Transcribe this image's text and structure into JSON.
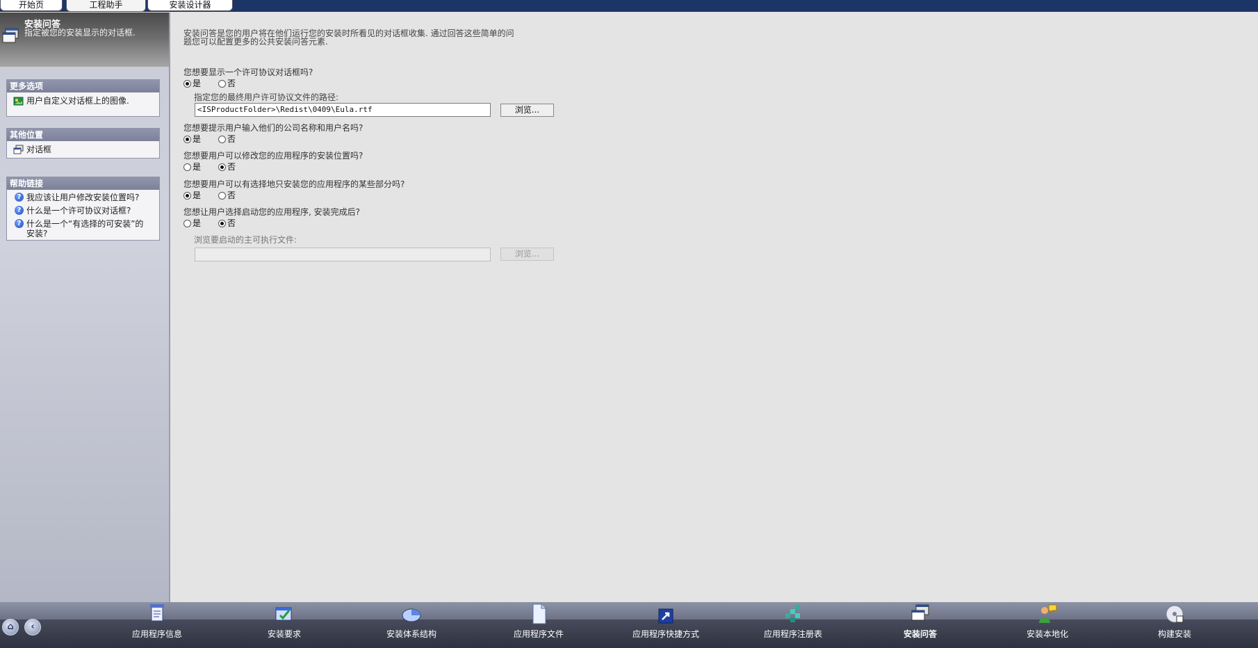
{
  "tabs": [
    {
      "label": "开始页"
    },
    {
      "label": "工程助手"
    },
    {
      "label": "安装设计器"
    }
  ],
  "left_panel": {
    "title": "安装问答",
    "subtitle": "指定被您的安装显示的对话框.",
    "more_options": {
      "heading": "更多选项",
      "items": [
        {
          "label": "用户自定义对话框上的图像."
        }
      ]
    },
    "other_locations": {
      "heading": "其他位置",
      "items": [
        {
          "label": "对话框"
        }
      ]
    },
    "help_links": {
      "heading": "帮助链接",
      "items": [
        {
          "label": "我应该让用户修改安装位置吗?"
        },
        {
          "label": "什么是一个许可协议对话框?"
        },
        {
          "label": "什么是一个“有选择的可安装”的安装?"
        }
      ]
    }
  },
  "main": {
    "intro": "安装问答是您的用户将在他们运行您的安装时所看见的对话框收集. 通过回答这些简单的问题您可以配置更多的公共安装问答元素.",
    "questions": [
      {
        "text": "您想要显示一个许可协议对话框吗?",
        "yes": "是",
        "no": "否",
        "selected": "yes",
        "path_label": "指定您的最终用户许可协议文件的路径:",
        "path_value": "<ISProductFolder>\\Redist\\0409\\Eula.rtf",
        "browse": "浏览..."
      },
      {
        "text": "您想要提示用户输入他们的公司名称和用户名吗?",
        "yes": "是",
        "no": "否",
        "selected": "yes"
      },
      {
        "text": "您想要用户可以修改您的应用程序的安装位置吗?",
        "yes": "是",
        "no": "否",
        "selected": "no"
      },
      {
        "text": "您想要用户可以有选择地只安装您的应用程序的某些部分吗?",
        "yes": "是",
        "no": "否",
        "selected": "yes"
      },
      {
        "text": "您想让用户选择启动您的应用程序, 安装完成后?",
        "yes": "是",
        "no": "否",
        "selected": "no",
        "exe_label": "浏览要启动的主可执行文件:",
        "exe_value": "",
        "browse": "浏览..."
      }
    ]
  },
  "bottom_nav": {
    "items": [
      {
        "label": "应用程序信息",
        "icon": "app-info-icon"
      },
      {
        "label": "安装要求",
        "icon": "install-requirements-icon"
      },
      {
        "label": "安装体系结构",
        "icon": "install-architecture-icon"
      },
      {
        "label": "应用程序文件",
        "icon": "app-files-icon"
      },
      {
        "label": "应用程序快捷方式",
        "icon": "shortcut-icon"
      },
      {
        "label": "应用程序注册表",
        "icon": "registry-icon"
      },
      {
        "label": "安装问答",
        "icon": "install-interview-icon",
        "active": true
      },
      {
        "label": "安装本地化",
        "icon": "localization-icon"
      },
      {
        "label": "构建安装",
        "icon": "build-icon"
      }
    ]
  },
  "colors": {
    "title_bar": "#1b3566",
    "panel_heading": "#7c8199",
    "bottom_bar": "#3b3f4f"
  }
}
